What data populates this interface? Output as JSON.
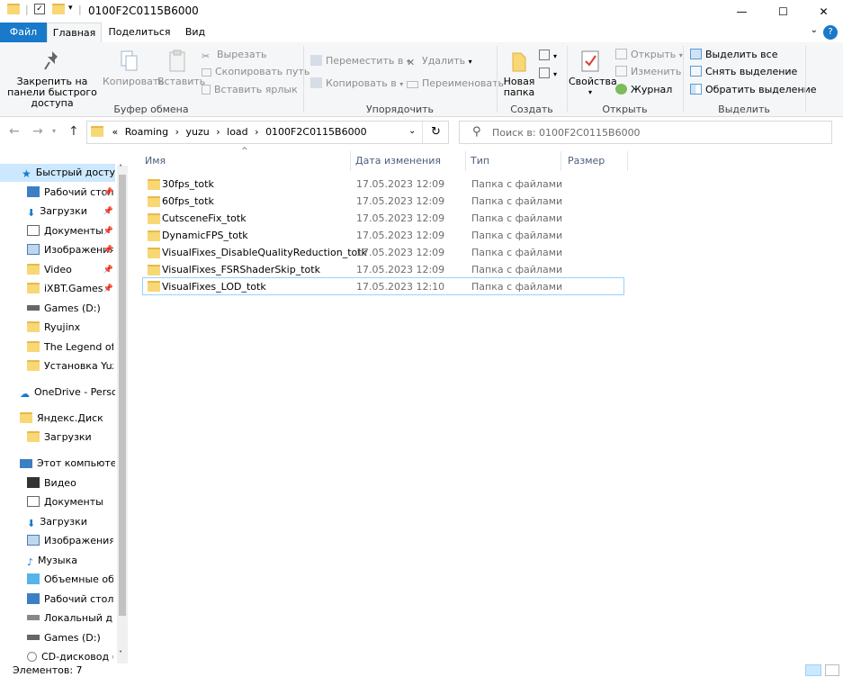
{
  "window": {
    "title": "0100F2C0115B6000",
    "minimize_glyph": "—",
    "maximize_glyph": "☐",
    "close_glyph": "✕"
  },
  "ribbon_tabs": {
    "file": "Файл",
    "home": "Главная",
    "share": "Поделиться",
    "view": "Вид"
  },
  "ribbon": {
    "clipboard": {
      "pin_label": "Закрепить на панели быстрого доступа",
      "copy_label": "Копировать",
      "paste_label": "Вставить",
      "cut_label": "Вырезать",
      "copy_path_label": "Скопировать путь",
      "paste_shortcut_label": "Вставить ярлык",
      "group_label": "Буфер обмена"
    },
    "organize": {
      "move_to_label": "Переместить в",
      "copy_to_label": "Копировать в",
      "delete_label": "Удалить",
      "rename_label": "Переименовать",
      "group_label": "Упорядочить"
    },
    "new": {
      "new_folder_label": "Новая папка",
      "group_label": "Создать"
    },
    "open": {
      "properties_label": "Свойства",
      "open_label": "Открыть",
      "edit_label": "Изменить",
      "history_label": "Журнал",
      "group_label": "Открыть"
    },
    "select": {
      "select_all_label": "Выделить все",
      "select_none_label": "Снять выделение",
      "invert_label": "Обратить выделение",
      "group_label": "Выделить"
    }
  },
  "address": {
    "overflow": "«",
    "crumbs": [
      "Roaming",
      "yuzu",
      "load",
      "0100F2C0115B6000"
    ],
    "separator": "›"
  },
  "search": {
    "placeholder": "Поиск в: 0100F2C0115B6000"
  },
  "nav_pane": {
    "quick_access": "Быстрый доступ",
    "quick_items": [
      "Рабочий стол",
      "Загрузки",
      "Документы",
      "Изображения",
      "Video",
      "iXBT.Games",
      "Games (D:)",
      "Ryujinx",
      "The Legend of Zelda",
      "Установка Yuzu"
    ],
    "onedrive": "OneDrive - Personal",
    "yandex": "Яндекс.Диск",
    "yandex_items": [
      "Загрузки"
    ],
    "this_pc": "Этот компьютер",
    "pc_items": [
      "Видео",
      "Документы",
      "Загрузки",
      "Изображения",
      "Музыка",
      "Объемные объекты",
      "Рабочий стол",
      "Локальный диск",
      "Games (D:)",
      "CD-дисковод (F:)"
    ]
  },
  "columns": {
    "name": "Имя",
    "date": "Дата изменения",
    "type": "Тип",
    "size": "Размер"
  },
  "files": [
    {
      "name": "30fps_totk",
      "date": "17.05.2023 12:09",
      "type": "Папка с файлами"
    },
    {
      "name": "60fps_totk",
      "date": "17.05.2023 12:09",
      "type": "Папка с файлами"
    },
    {
      "name": "CutsceneFix_totk",
      "date": "17.05.2023 12:09",
      "type": "Папка с файлами"
    },
    {
      "name": "DynamicFPS_totk",
      "date": "17.05.2023 12:09",
      "type": "Папка с файлами"
    },
    {
      "name": "VisualFixes_DisableQualityReduction_totk",
      "date": "17.05.2023 12:09",
      "type": "Папка с файлами"
    },
    {
      "name": "VisualFixes_FSRShaderSkip_totk",
      "date": "17.05.2023 12:09",
      "type": "Папка с файлами"
    },
    {
      "name": "VisualFixes_LOD_totk",
      "date": "17.05.2023 12:10",
      "type": "Папка с файлами"
    }
  ],
  "status": {
    "items_count": "Элементов: 7"
  },
  "colors": {
    "file_tab": "#1979ca",
    "selection": "#cce8ff",
    "selected_row_border": "#99d1ff",
    "folder": "#f8d775"
  }
}
